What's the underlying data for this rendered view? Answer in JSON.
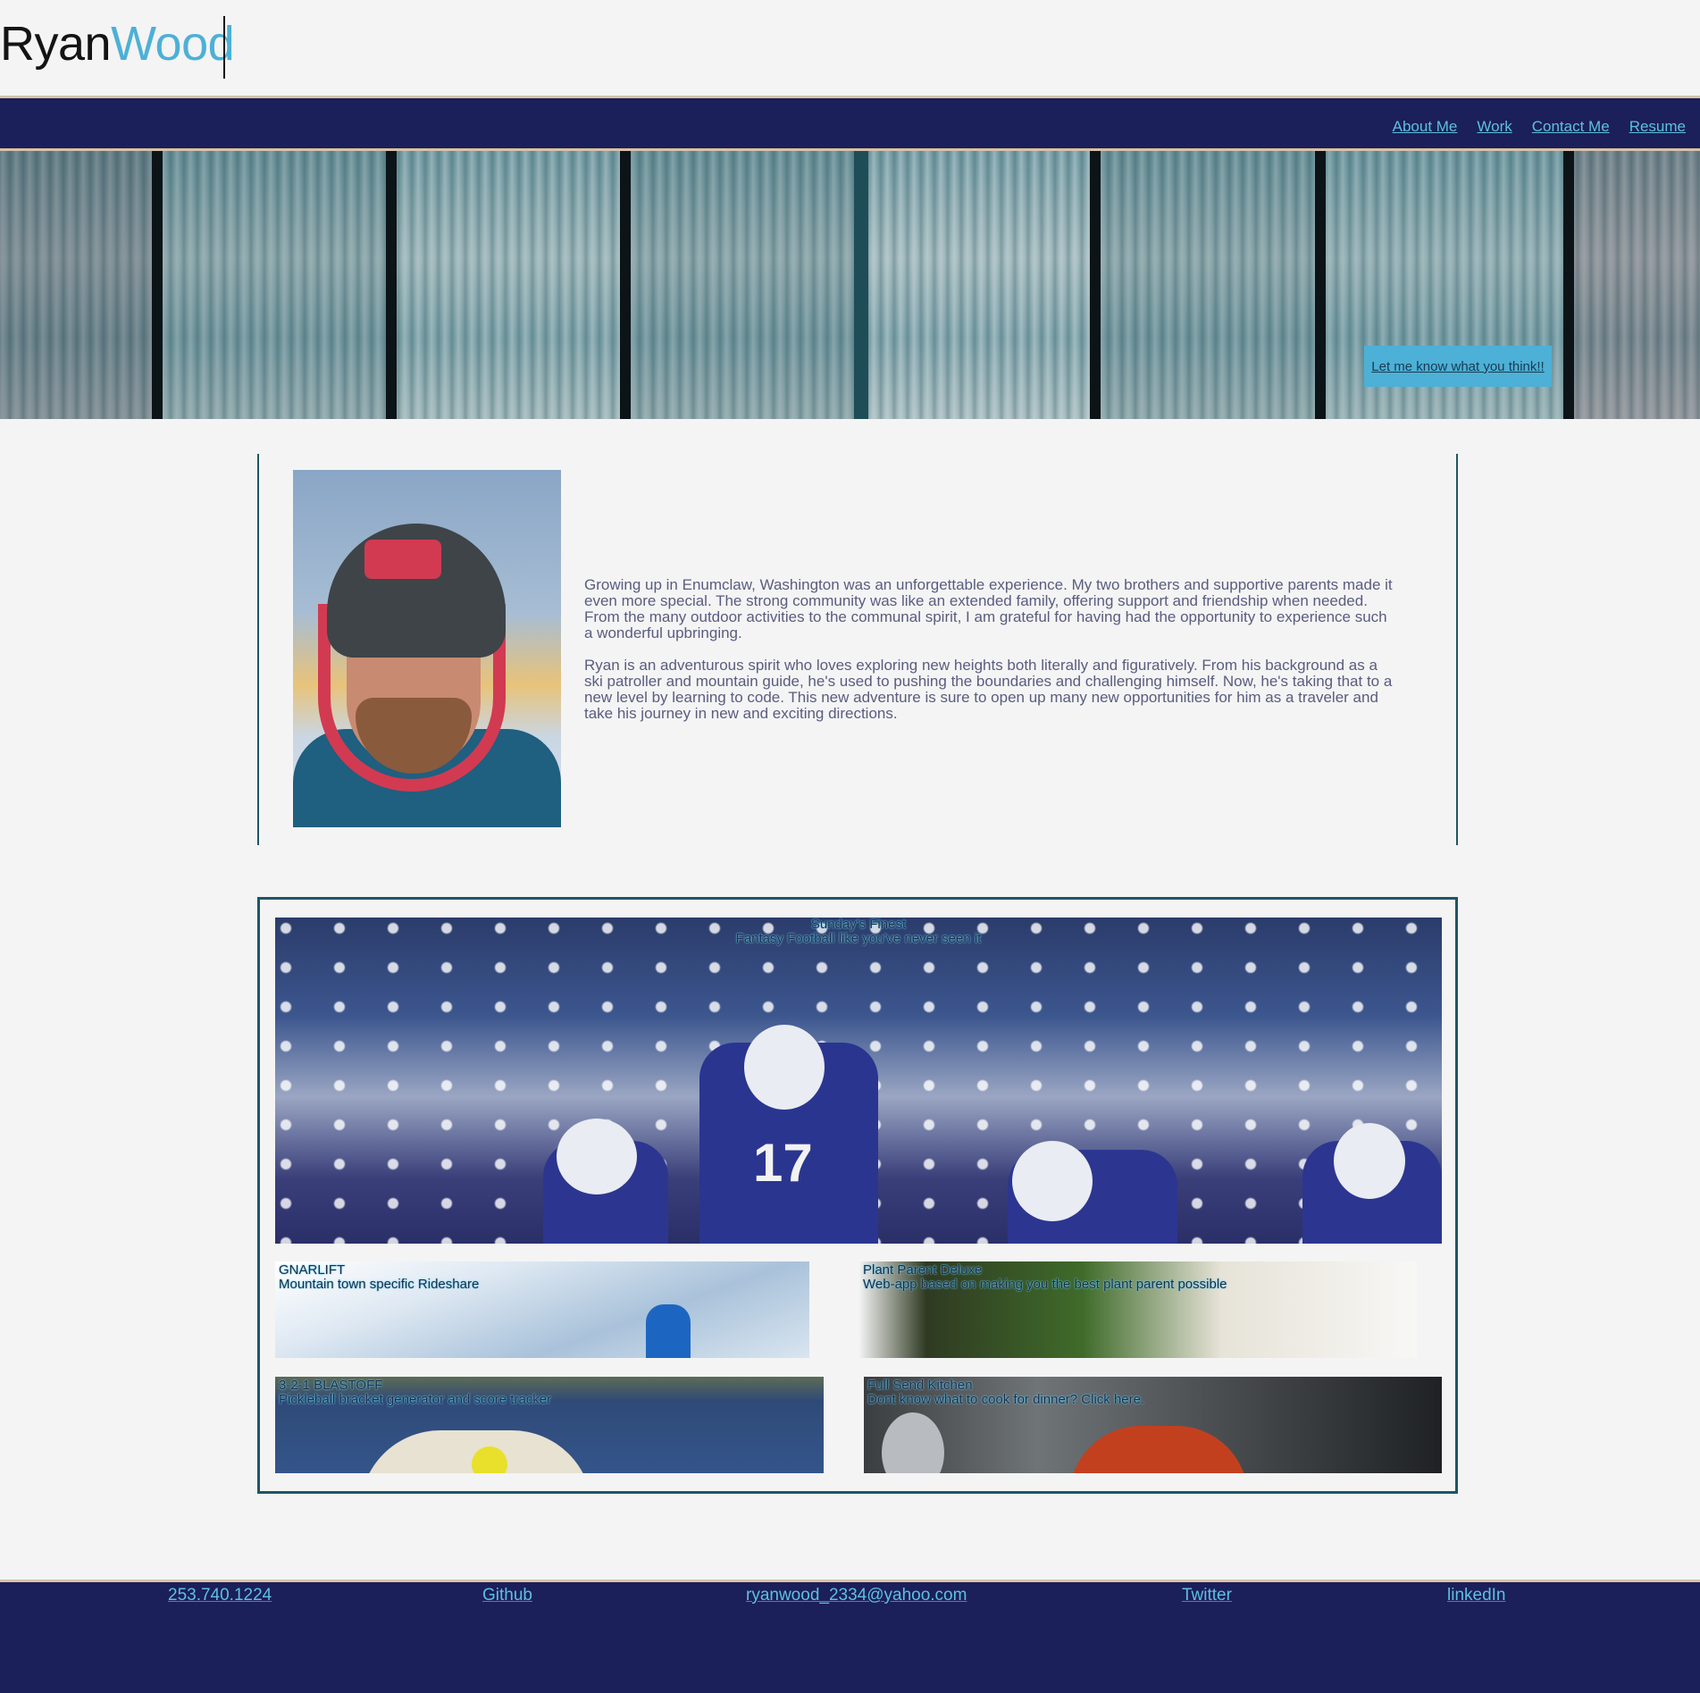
{
  "header": {
    "logo_first": "Ryan",
    "logo_last": "Wood"
  },
  "nav": {
    "items": [
      "About Me",
      "Work",
      "Contact Me",
      "Resume"
    ]
  },
  "hero": {
    "cta_label": "Let me know what you think!!"
  },
  "about": {
    "paragraphs": [
      "Growing up in Enumclaw, Washington was an unforgettable experience. My two brothers and supportive parents made it even more special. The strong community was like an extended family, offering support and friendship when needed. From the many outdoor activities to the communal spirit, I am grateful for having had the opportunity to experience such a wonderful upbringing.",
      "Ryan is an adventurous spirit who loves exploring new heights both literally and figuratively. From his background as a ski patroller and mountain guide, he's used to pushing the boundaries and challenging himself. Now, he's taking that to a new level by learning to code. This new adventure is sure to open up many new opportunities for him as a traveler and take his journey in new and exciting directions."
    ]
  },
  "work": {
    "projects": [
      {
        "title": "Sunday's Finest",
        "subtitle": "Fantasy Football like you've never seen it"
      },
      {
        "title": "GNARLIFT",
        "subtitle": "Mountain town specific Rideshare"
      },
      {
        "title": "Plant Parent Deluxe",
        "subtitle": "Web-app based on making you the best plant parent possible"
      },
      {
        "title": "3-2-1 BLASTOFF",
        "subtitle": "Pickleball bracket generator and score tracker"
      },
      {
        "title": "Full Send Kitchen",
        "subtitle": "Dont know what to cook for dinner? Click here."
      }
    ],
    "jersey_number": "17"
  },
  "footer": {
    "links": [
      "253.740.1224",
      "Github",
      "ryanwood_2334@yahoo.com",
      "Twitter",
      "linkedIn"
    ]
  },
  "colors": {
    "navy": "#1b1f5a",
    "accent": "#4db0d6",
    "border_tan": "#d8c2a4",
    "teal_border": "#1f5566"
  }
}
